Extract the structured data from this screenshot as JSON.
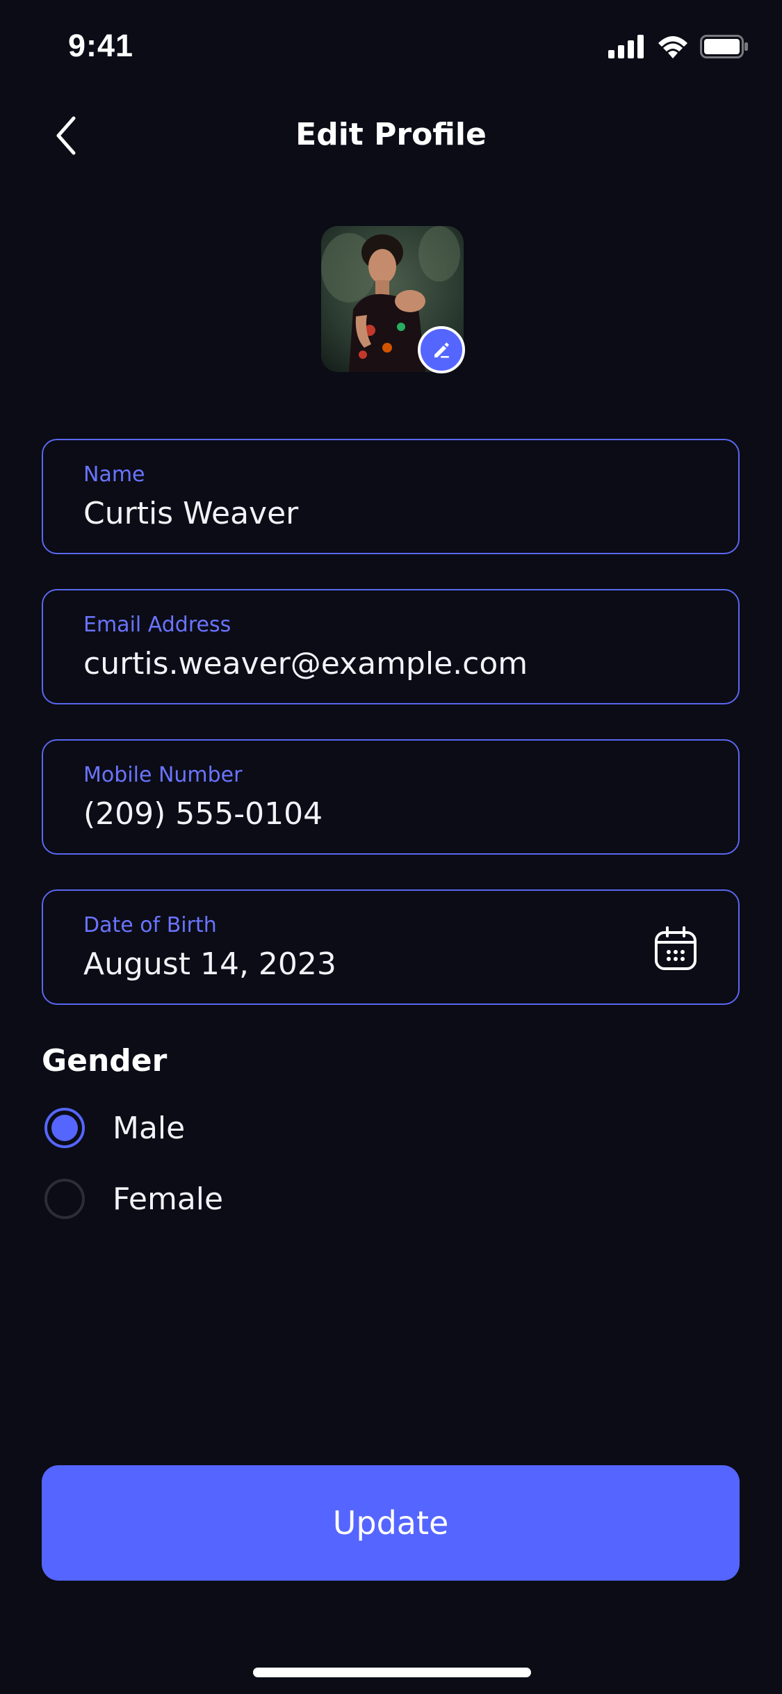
{
  "status_bar": {
    "time": "9:41",
    "icons": [
      "signal-icon",
      "wifi-icon",
      "battery-icon"
    ]
  },
  "header": {
    "back_icon": "chevron-left-icon",
    "title": "Edit Profile"
  },
  "avatar": {
    "edit_icon": "pencil-icon"
  },
  "form": {
    "name": {
      "label": "Name",
      "value": "Curtis Weaver"
    },
    "email": {
      "label": "Email Address",
      "value": "curtis.weaver@example.com"
    },
    "mobile": {
      "label": "Mobile Number",
      "value": "(209) 555-0104"
    },
    "dob": {
      "label": "Date of Birth",
      "value": "August 14, 2023",
      "icon": "calendar-icon"
    }
  },
  "gender": {
    "title": "Gender",
    "options": [
      {
        "label": "Male",
        "selected": true
      },
      {
        "label": "Female",
        "selected": false
      }
    ]
  },
  "actions": {
    "update_label": "Update"
  },
  "colors": {
    "background": "#0b0c16",
    "accent": "#5565ff",
    "field_border": "#5a67f0",
    "label": "#6a74ff"
  }
}
